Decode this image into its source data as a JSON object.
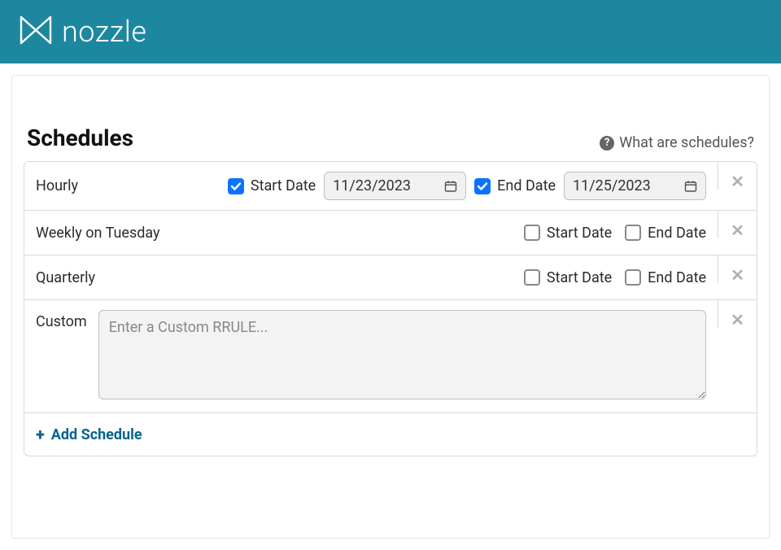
{
  "brand": {
    "name": "nozzle"
  },
  "page": {
    "title": "Schedules",
    "help_label": "What are schedules?"
  },
  "schedules": [
    {
      "name": "Hourly",
      "start_checked": true,
      "start_label": "Start Date",
      "start_value": "11/23/2023",
      "end_checked": true,
      "end_label": "End Date",
      "end_value": "11/25/2023",
      "type": "dated"
    },
    {
      "name": "Weekly on Tuesday",
      "start_checked": false,
      "start_label": "Start Date",
      "end_checked": false,
      "end_label": "End Date",
      "type": "simple"
    },
    {
      "name": "Quarterly",
      "start_checked": false,
      "start_label": "Start Date",
      "end_checked": false,
      "end_label": "End Date",
      "type": "simple"
    },
    {
      "name": "Custom",
      "type": "custom",
      "placeholder": "Enter a Custom RRULE..."
    }
  ],
  "add_label": "Add Schedule"
}
